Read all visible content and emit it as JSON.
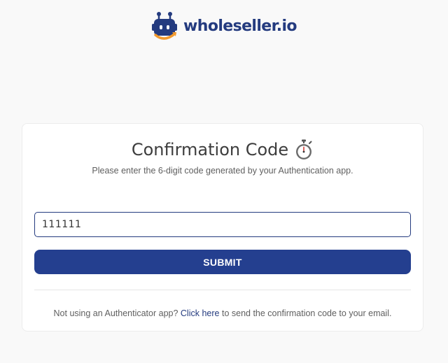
{
  "brand": {
    "name": "wholeseller.io",
    "colors": {
      "primary": "#243b7f",
      "accent": "#f29a2e"
    }
  },
  "card": {
    "title": "Confirmation Code",
    "title_icon": "stopwatch-icon",
    "subtitle": "Please enter the 6-digit code generated by your Authentication app.",
    "code_input": {
      "value": "111111",
      "placeholder": ""
    },
    "submit_label": "SUBMIT",
    "footer": {
      "prefix": "Not using an Authenticator app?",
      "link_text": "Click here",
      "suffix": "to send the confirmation code to your email."
    }
  },
  "colors": {
    "button_bg": "#243f8f",
    "link": "#243b7f",
    "page_bg": "#f9f9f9"
  }
}
